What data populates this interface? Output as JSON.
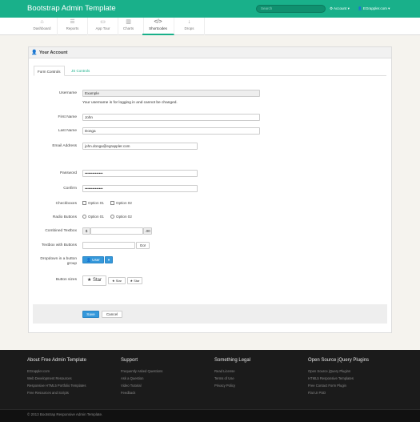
{
  "app": {
    "title": "Bootstrap Admin Template"
  },
  "header": {
    "search_placeholder": "Search",
    "account_label": "Account",
    "user_label": "EGrappler.com"
  },
  "nav": {
    "items": [
      {
        "label": "Dashboard",
        "icon": "dashboard-icon",
        "glyph": "⌂"
      },
      {
        "label": "Reports",
        "icon": "reports-icon",
        "glyph": "☰"
      },
      {
        "label": "App Tour",
        "icon": "app-tour-icon",
        "glyph": "▭"
      },
      {
        "label": "Charts",
        "icon": "charts-icon",
        "glyph": "▥"
      },
      {
        "label": "Shortcodes",
        "icon": "code-icon",
        "glyph": "</>"
      },
      {
        "label": "Drops",
        "icon": "arrow-down-icon",
        "glyph": "↓"
      }
    ],
    "active_index": 4
  },
  "panel": {
    "title": "Your Account",
    "tabs": [
      "Form Controls",
      "JS Controls"
    ]
  },
  "form": {
    "username_label": "Username",
    "username_value": "Example",
    "username_help": "Your username is for logging in and cannot be changed.",
    "firstname_label": "First Name",
    "firstname_value": "John",
    "lastname_label": "Last Name",
    "lastname_value": "Donga",
    "email_label": "Email Address",
    "email_value": "john.donga@egrappler.com",
    "password_label": "Password",
    "password_value": "••••••••••••••",
    "confirm_label": "Confirm",
    "confirm_value": "••••••••••••••",
    "checkboxes_label": "Checkboxes",
    "checkbox_options": [
      "Option 01",
      "Option 02"
    ],
    "radio_label": "Radio Buttons",
    "radio_options": [
      "Option 01",
      "Option 02"
    ],
    "combined_label": "Combined Textbox",
    "combined_prefix": "$",
    "combined_suffix": ".00",
    "textbox_buttons_label": "Textbox with Buttons",
    "go_label": "Go!",
    "dropdown_label": "Dropdown in a button group",
    "dropdown_button": "User",
    "button_sizes_label": "Button sizes",
    "star_label": "Star",
    "save_label": "Save",
    "cancel_label": "Cancel"
  },
  "footer": {
    "columns": [
      {
        "heading": "About Free Admin Template",
        "links": [
          "EGrappler.com",
          "Web Development Resources",
          "Responsive HTML5 Portfolio Templates",
          "Free Resources and Scripts"
        ]
      },
      {
        "heading": "Support",
        "links": [
          "Frequently Asked Questions",
          "Ask a Question",
          "Video Tutorial",
          "Feedback"
        ]
      },
      {
        "heading": "Something Legal",
        "links": [
          "Read License",
          "Terms of Use",
          "Privacy Policy"
        ]
      },
      {
        "heading": "Open Source jQuery Plugins",
        "links": [
          "Open Source jQuery Plugins",
          "HTML5 Responsive Templates",
          "Free Contact Form Plugin",
          "Flat UI PSD"
        ]
      }
    ],
    "copyright": "© 2013 Bootstrap Responsive Admin Template."
  },
  "colors": {
    "brand": "#19b08a",
    "primary_button": "#3498db",
    "footer": "#1b1b1b"
  }
}
